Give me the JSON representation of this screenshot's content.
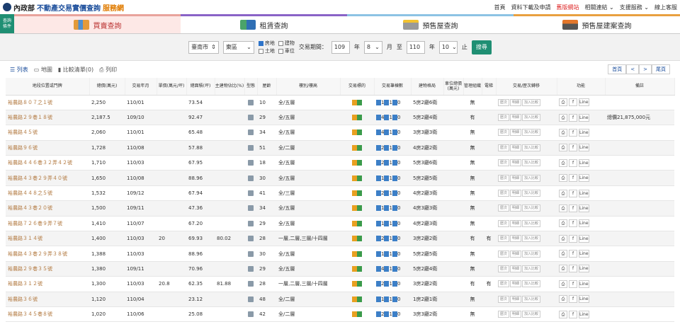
{
  "header": {
    "logo_a": "內政部",
    "logo_b": "不動產交易實價查詢",
    "logo_c": "服務網",
    "nav": [
      "首頁",
      "資料下載及申請",
      "舊版網站",
      "相關連結 ⌄",
      "支援服務 ⌄",
      "線上客服"
    ]
  },
  "side_label": [
    "查詢",
    "條件"
  ],
  "tabs": [
    "買賣查詢",
    "租賃查詢",
    "預售屋查詢",
    "預售屋建案查詢"
  ],
  "filter": {
    "city": "臺南市",
    "district": "東區",
    "checks": [
      "房地",
      "建物",
      "土地",
      "車位"
    ],
    "period_label": "交易期間：",
    "y1": "109",
    "y_label1": "年",
    "m1": "8",
    "m_label1": "月",
    "to": "至",
    "y2": "110",
    "y_label2": "年",
    "m2": "10",
    "m_label2": "止",
    "search": "搜尋"
  },
  "tools": {
    "list": "列表",
    "map": "地圖",
    "compare": "比較清單(0)",
    "print": "列印"
  },
  "pager": [
    "首頁",
    "<",
    ">",
    "尾頁"
  ],
  "columns": [
    "地段位置或門牌",
    "總價(萬元)",
    "交易年月",
    "單價(萬元/坪)",
    "總面積(坪)",
    "主建物佔比(%)",
    "型態",
    "屋齡",
    "樓別/樓高",
    "交易標的",
    "交易筆棟數",
    "建物格局",
    "車位總價(萬元)",
    "管理組織",
    "電梯",
    "交易/歷次轉移",
    "功能",
    "備註"
  ],
  "row_buttons": {
    "history": "歷次",
    "detail": "明細",
    "add": "加入比較",
    "share_f": "f",
    "share_line": "Line"
  },
  "rows": [
    [
      "裕農路８０７之１號",
      "2,250",
      "110/01",
      "",
      "73.54",
      "",
      "10",
      "全/五層",
      "1",
      "1",
      "0",
      "5房2廳6衛",
      "",
      "無",
      "",
      ""
    ],
    [
      "裕農路２９巷１８號",
      "2,187.5",
      "109/10",
      "",
      "92.47",
      "",
      "29",
      "全/五層",
      "4",
      "1",
      "0",
      "5房2廳4衛",
      "",
      "有",
      "",
      "總價21,875,000元"
    ],
    [
      "裕農路４５號",
      "2,060",
      "110/01",
      "",
      "65.48",
      "",
      "34",
      "全/五層",
      "4",
      "1",
      "0",
      "3房3廳3衛",
      "",
      "無",
      "",
      ""
    ],
    [
      "裕農路９６號",
      "1,728",
      "110/08",
      "",
      "57.88",
      "",
      "51",
      "全/二層",
      "2",
      "1",
      "0",
      "4房2廳2衛",
      "",
      "無",
      "",
      ""
    ],
    [
      "裕農路４４６巷３２弄４２號",
      "1,710",
      "110/03",
      "",
      "67.95",
      "",
      "18",
      "全/五層",
      "2",
      "1",
      "0",
      "5房3廳6衛",
      "",
      "無",
      "",
      ""
    ],
    [
      "裕農路４３巷２９弄４０號",
      "1,650",
      "110/08",
      "",
      "88.96",
      "",
      "30",
      "全/五層",
      "1",
      "1",
      "0",
      "5房2廳5衛",
      "",
      "無",
      "",
      ""
    ],
    [
      "裕農路４４８之５號",
      "1,532",
      "109/12",
      "",
      "67.94",
      "",
      "41",
      "全/三層",
      "2",
      "1",
      "0",
      "4房2廳3衛",
      "",
      "無",
      "",
      ""
    ],
    [
      "裕農路４３巷２０號",
      "1,500",
      "109/11",
      "",
      "47.36",
      "",
      "34",
      "全/五層",
      "1",
      "1",
      "0",
      "4房3廳3衛",
      "",
      "無",
      "",
      ""
    ],
    [
      "裕農路７２６巷９弄７號",
      "1,410",
      "110/07",
      "",
      "67.20",
      "",
      "29",
      "全/五層",
      "1",
      "1",
      "0",
      "4房2廳3衛",
      "",
      "無",
      "",
      ""
    ],
    [
      "裕農路３１４號",
      "1,400",
      "110/03",
      "20",
      "69.93",
      "80.02",
      "28",
      "一層,二層,三層/十四層",
      "2",
      "1",
      "0",
      "3房2廳2衛",
      "",
      "有",
      "有",
      ""
    ],
    [
      "裕農路４３巷２９弄３８號",
      "1,388",
      "110/03",
      "",
      "88.96",
      "",
      "30",
      "全/五層",
      "1",
      "1",
      "0",
      "5房2廳5衛",
      "",
      "無",
      "",
      ""
    ],
    [
      "裕農路２９巷３５號",
      "1,380",
      "109/11",
      "",
      "70.96",
      "",
      "29",
      "全/五層",
      "4",
      "1",
      "0",
      "5房2廳4衛",
      "",
      "無",
      "",
      ""
    ],
    [
      "裕農路３１２號",
      "1,300",
      "110/03",
      "20.8",
      "62.35",
      "81.88",
      "28",
      "一層,二層,三層/十四層",
      "2",
      "1",
      "0",
      "3房2廳2衛",
      "",
      "有",
      "有",
      ""
    ],
    [
      "裕農路３６號",
      "1,120",
      "110/04",
      "",
      "23.12",
      "",
      "48",
      "全/二層",
      "1",
      "1",
      "0",
      "1房2廳1衛",
      "",
      "無",
      "",
      ""
    ],
    [
      "裕農路３４５巷８號",
      "1,020",
      "110/06",
      "",
      "25.08",
      "",
      "42",
      "全/二層",
      "2",
      "1",
      "0",
      "3房3廳2衛",
      "",
      "無",
      "",
      ""
    ]
  ],
  "colors": {
    "accent": "#1f8f73",
    "brand": "#1d4f9c",
    "address": "#b0753a"
  }
}
